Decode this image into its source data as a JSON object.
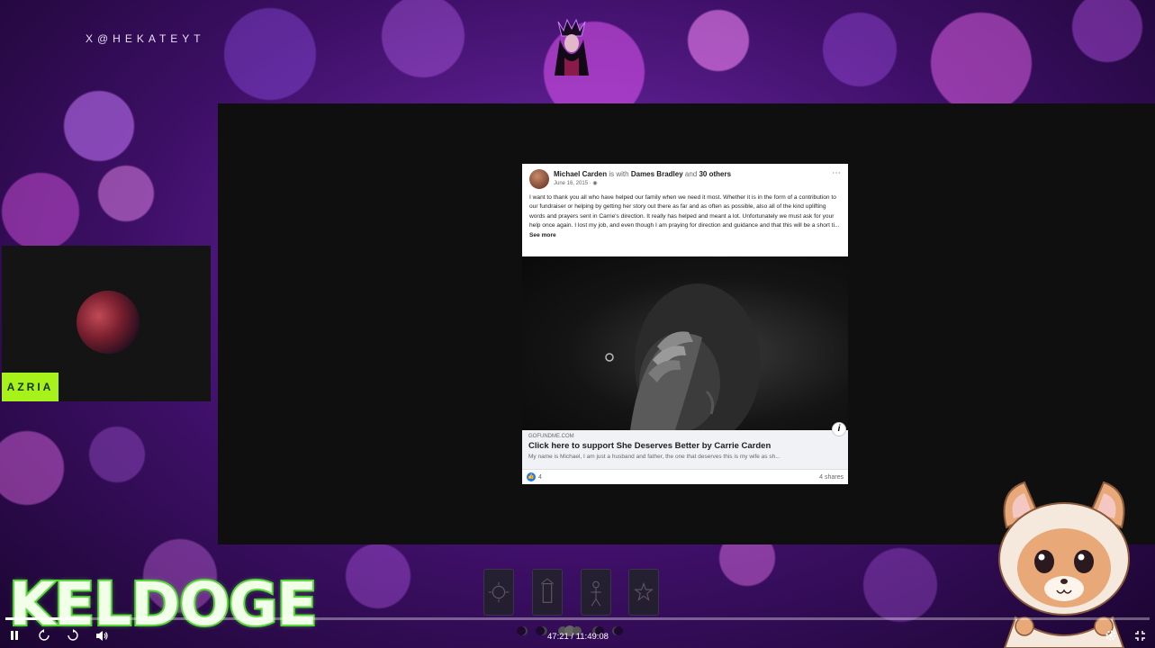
{
  "stream": {
    "handle": "X@HEKATEYT",
    "streamer_name": "AZRIA",
    "sponsor_logo_text": "KELDOGE"
  },
  "post": {
    "author": "Michael Carden",
    "with_text": "is with",
    "tagged": "Dames Bradley",
    "and_text": "and",
    "others": "30 others",
    "date": "June 16, 2015 ·",
    "body": "I want to thank you all who have helped our family when we need it most. Whether it is in the form of a contribution to our fundraiser or helping by getting her story out there as far and as often as possible, also all of the kind uplifting words and prayers sent in Carrie's direction. It really has helped and meant a lot. Unfortunately we must ask for your help once again. I lost my job, and even though I am praying for direction and guidance and that this will be a short ti...",
    "see_more": "See more",
    "link_domain": "GOFUNDME.COM",
    "link_title": "Click here to support She Deserves Better by Carrie Carden",
    "link_desc": "My name is Michael, I am just a husband and father, the one that deserves this is my wife as sh...",
    "reaction_count": "4",
    "shares": "4 shares",
    "info_badge": "i"
  },
  "player": {
    "time": "47:21 / 11:49:08",
    "progress": 0.067
  },
  "icons": {
    "pause": "pause-icon",
    "rewind": "rewind-10-icon",
    "forward": "forward-10-icon",
    "volume": "volume-icon",
    "settings": "settings-icon",
    "fullscreen": "exit-fullscreen-icon",
    "more": "more-options-icon",
    "globe": "globe-icon",
    "like": "like-icon"
  },
  "colors": {
    "accent_green": "#a7f21a",
    "keldoge_outline": "#57d93a",
    "facebook_blue": "#2078f4"
  }
}
